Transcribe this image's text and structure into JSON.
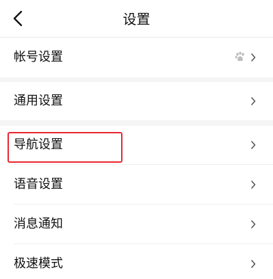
{
  "header": {
    "title": "设置",
    "back_icon": "back-arrow-icon"
  },
  "menu": {
    "items": [
      {
        "label": "帐号设置",
        "icon": "paw-icon"
      },
      {
        "label": "通用设置"
      },
      {
        "label": "导航设置",
        "highlighted": true
      },
      {
        "label": "语音设置"
      },
      {
        "label": "消息通知"
      },
      {
        "label": "极速模式"
      }
    ]
  },
  "colors": {
    "highlight_border": "#e8242c",
    "text": "#111111",
    "chevron": "#555555",
    "separator": "#efefef",
    "section_gap": "#f5f5f5"
  }
}
